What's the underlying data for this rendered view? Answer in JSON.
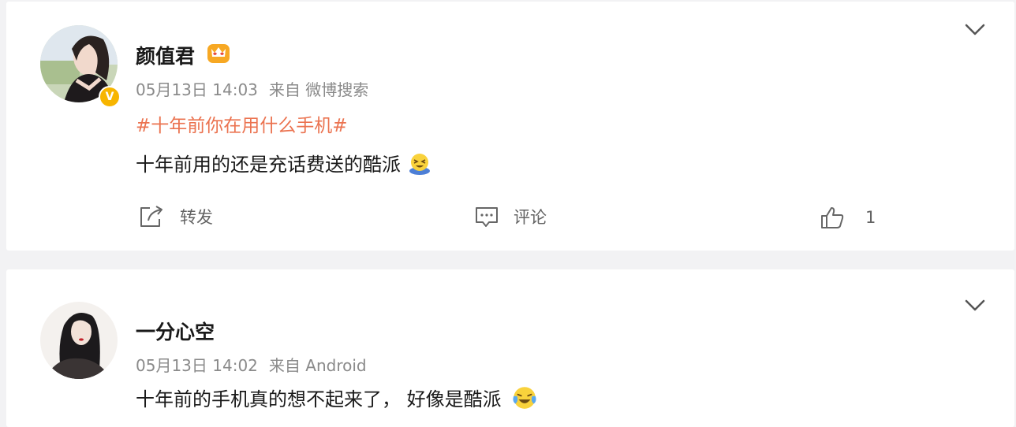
{
  "posts": [
    {
      "username": "颜值君",
      "date": "05月13日 14:03",
      "source": "来自 微博搜索",
      "hashtag": "#十年前你在用什么手机#",
      "text": "十年前用的还是充话费送的酷派",
      "verified_badge": "V",
      "actions": {
        "repost": "转发",
        "comment": "评论",
        "like_count": "1"
      }
    },
    {
      "username": "一分心空",
      "date": "05月13日 14:02",
      "source": "来自 Android",
      "text": "十年前的手机真的想不起来了， 好像是酷派"
    }
  ],
  "icons": {
    "expand": "chevron-down-icon",
    "repost": "share-icon",
    "comment": "comment-icon",
    "like": "thumbs-up-icon",
    "crown": "crown-icon",
    "emoji_1": "laughing-emoji",
    "emoji_2": "crying-laughing-emoji"
  },
  "colors": {
    "hashtag": "#eb7350",
    "verified": "#f7b500",
    "meta": "#8a8a8a"
  }
}
